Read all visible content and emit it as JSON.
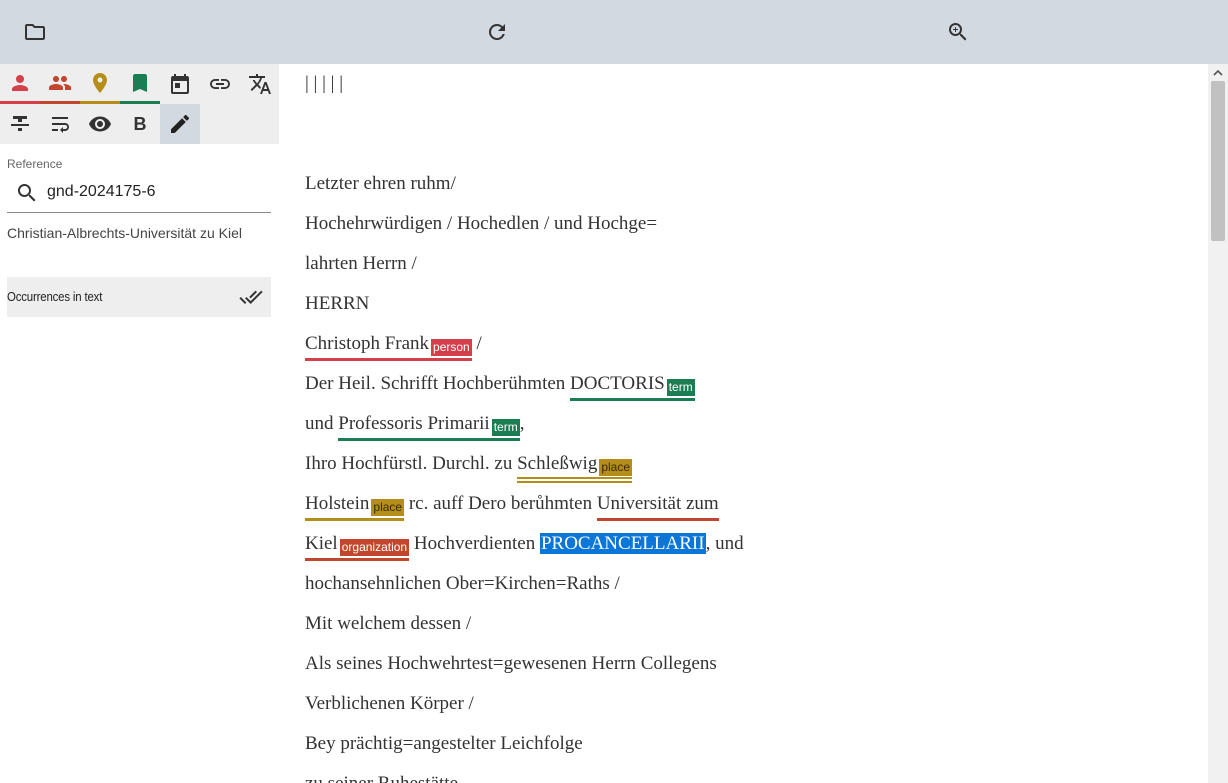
{
  "toolbar": {
    "icons": [
      "folder-icon",
      "refresh-icon",
      "zoom-in-icon"
    ]
  },
  "annotation_tools": {
    "row1": [
      "person-icon",
      "persons-group-icon",
      "place-pin-icon",
      "bookmark-icon",
      "calendar-icon",
      "link-icon",
      "translate-icon"
    ],
    "row2": [
      "strikethrough-icon",
      "wrap-text-icon",
      "eye-icon",
      "bold-icon",
      "edit-pencil-icon"
    ],
    "underline_colors": {
      "person": "#d43f4a",
      "group": "#c2452d",
      "place": "#b58e1a",
      "term": "#1b7d52"
    },
    "bold_label": "B"
  },
  "reference": {
    "label": "Reference",
    "value": "gnd-2024175-6",
    "description": "Christian-Albrechts-Universität zu Kiel"
  },
  "occurrences": {
    "label": "Occurrences in text"
  },
  "text": {
    "line1": "| | | | |",
    "line2": "Letzter ehren ruhm/",
    "line3": "Hochehrwürdigen / Hochedlen / und Hochge=",
    "line4": "lahrten Herrn /",
    "line5": "HERRN",
    "line6": {
      "entity": "Christoph Frank",
      "tag": "person",
      "after": " /"
    },
    "line7": {
      "before": "Der Heil. Schrifft Hochberühmten ",
      "entity": "DOCTORIS",
      "tag": "term"
    },
    "line8": {
      "before": "und ",
      "entity": "Professoris Primarii",
      "tag": "term",
      "after": ","
    },
    "line9": {
      "before": "Ihro Hochfürstl. Durchl. zu ",
      "entity": "Schleßwig",
      "tag": "place"
    },
    "line10": {
      "entity": "Holstein",
      "tag": "place",
      "middle": " rc. auff Dero berůhmten ",
      "entity2": "Universität zum"
    },
    "line11": {
      "entity": "Kiel",
      "tag": "organization",
      "middle": " Hochverdienten ",
      "selected": "PROCANCELLARII",
      "after": ", und"
    },
    "line12": "hochansehnlichen Ober=Kirchen=Raths /",
    "line13": "Mit welchem dessen /",
    "line14": "Als seines Hochwehrtest=gewesenen Herrn Collegens",
    "line15": "Verblichenen Körper /",
    "line16": "Bey prächtig=angestelter Leichfolge",
    "line17": "zu seiner Ruhestätte"
  },
  "colors": {
    "toolbar_bg": "#d3d9e1",
    "selection": "#0a76d8"
  }
}
